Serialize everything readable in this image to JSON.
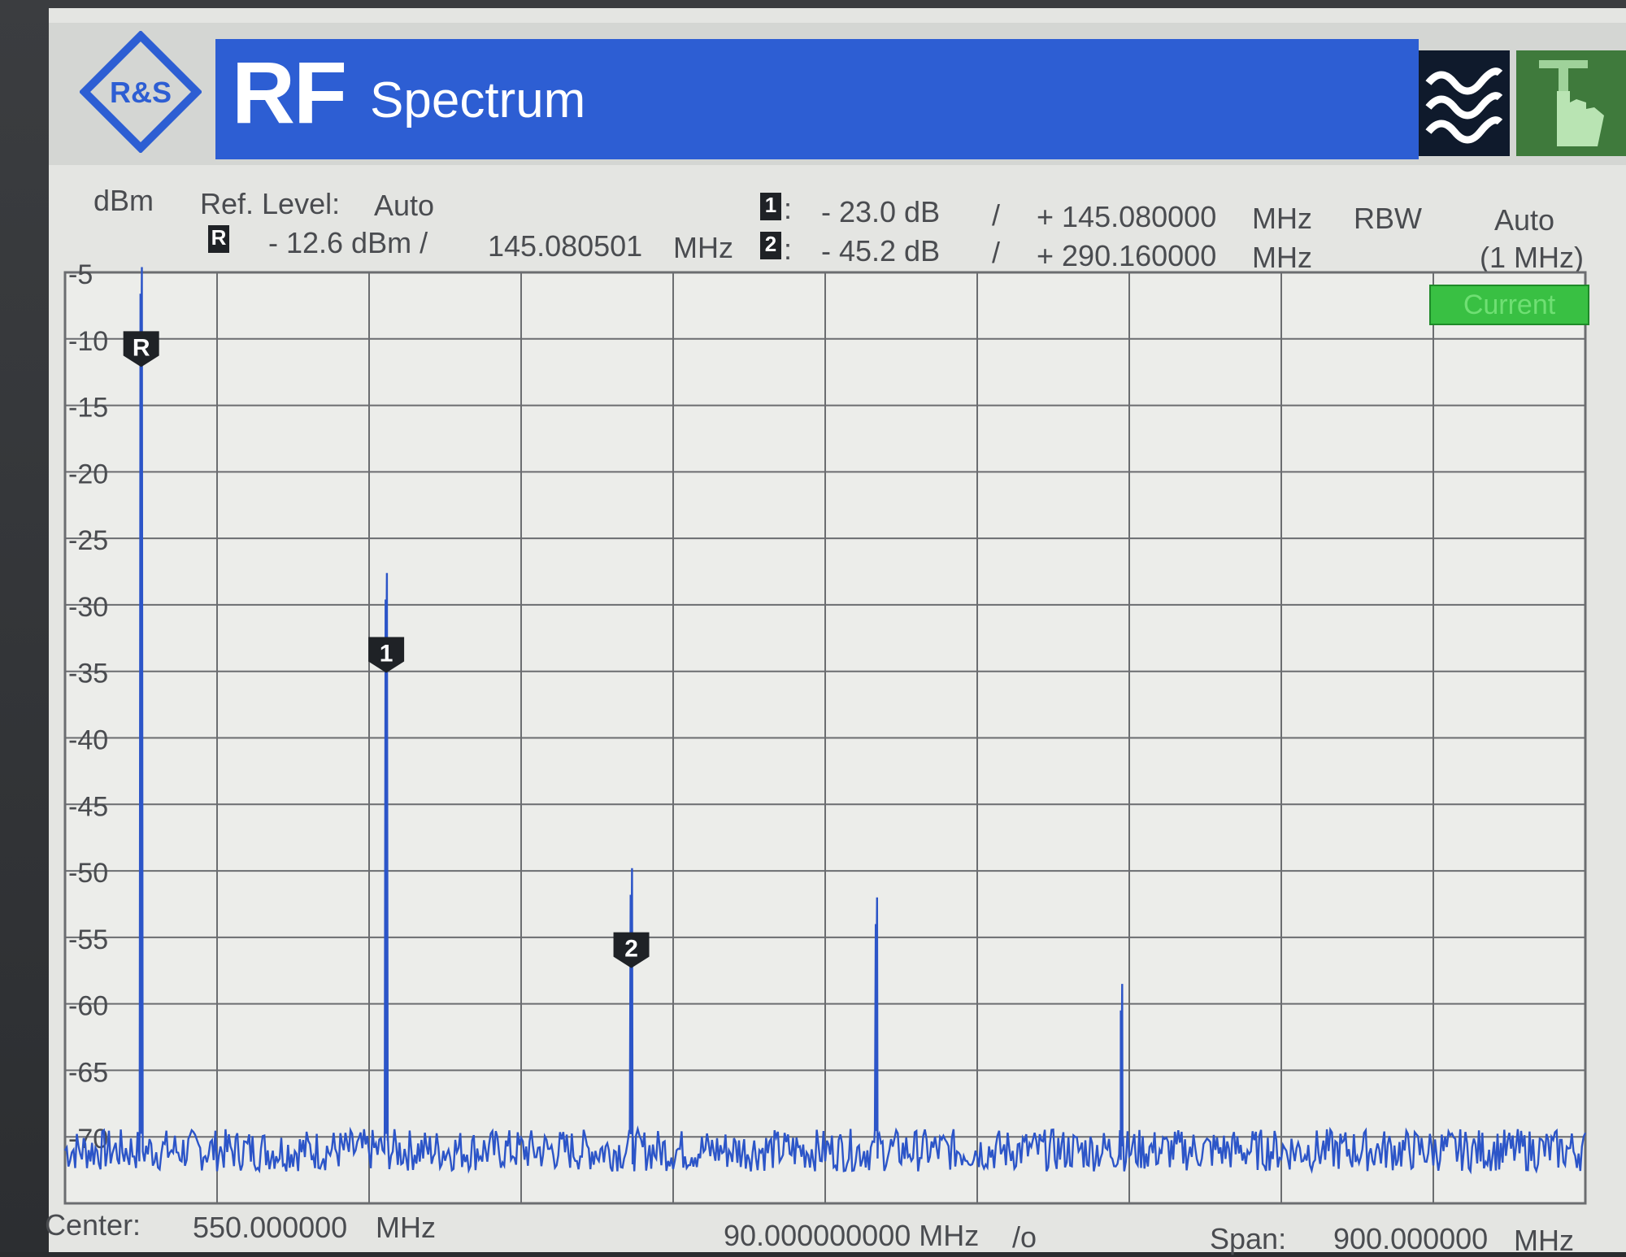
{
  "header": {
    "rf_label": "RF",
    "app_title": "Spectrum",
    "logo_text": "R&S",
    "wave_icon": "wave-icon",
    "touch_icon": "touch-hand-icon"
  },
  "info": {
    "unit": "dBm",
    "ref_level_label": "Ref. Level:",
    "ref_level_value": "Auto",
    "ref_marker_badge": "R",
    "ref_marker_level": "- 12.6 dBm /",
    "ref_marker_freq": "145.080501",
    "ref_marker_freq_unit": "MHz",
    "marker1_badge": "1",
    "marker1_colon": ":",
    "marker1_level": "- 23.0 dB",
    "marker1_sep": "/",
    "marker1_freq": "+ 145.080000",
    "marker1_unit": "MHz",
    "marker2_badge": "2",
    "marker2_colon": ":",
    "marker2_level": "- 45.2 dB",
    "marker2_sep": "/",
    "marker2_freq": "+ 290.160000",
    "marker2_unit": "MHz",
    "rbw_label": "RBW",
    "rbw_mode": "Auto",
    "rbw_value": "(1 MHz)",
    "trace_badge": "Current"
  },
  "footer": {
    "center_label": "Center:",
    "center_value": "550.000000",
    "center_unit": "MHz",
    "div_value": "90.000000000 MHz",
    "div_unit": "/o",
    "span_label": "Span:",
    "span_value": "900.000000",
    "span_unit": "MHz"
  },
  "colors": {
    "trace": "#2c55c8",
    "grid": "#6b6d70",
    "background": "#e4e5e2",
    "title_bar": "#2d5ed3"
  },
  "chart_data": {
    "type": "line",
    "xlabel": "",
    "ylabel": "dBm",
    "xlim": [
      100,
      1000
    ],
    "ylim": [
      -75,
      -5
    ],
    "y_ticks": [
      "-5",
      "-10",
      "-15",
      "-20",
      "-25",
      "-30",
      "-35",
      "-40",
      "-45",
      "-50",
      "-55",
      "-60",
      "-65",
      "-70"
    ],
    "y_tick_values": [
      -5,
      -10,
      -15,
      -20,
      -25,
      -30,
      -35,
      -40,
      -45,
      -50,
      -55,
      -60,
      -65,
      -70
    ],
    "grid": true,
    "noise_floor": -71,
    "peaks": [
      {
        "x": 145.08,
        "y": -12.6
      },
      {
        "x": 290.16,
        "y": -35.6
      },
      {
        "x": 435.24,
        "y": -57.8
      },
      {
        "x": 580.32,
        "y": -60.0
      },
      {
        "x": 725.4,
        "y": -66.5
      }
    ],
    "markers": [
      {
        "label": "R",
        "x": 145.08,
        "y": -12.6
      },
      {
        "label": "1",
        "x": 290.16,
        "y": -35.6
      },
      {
        "label": "2",
        "x": 435.24,
        "y": -57.8
      }
    ]
  }
}
